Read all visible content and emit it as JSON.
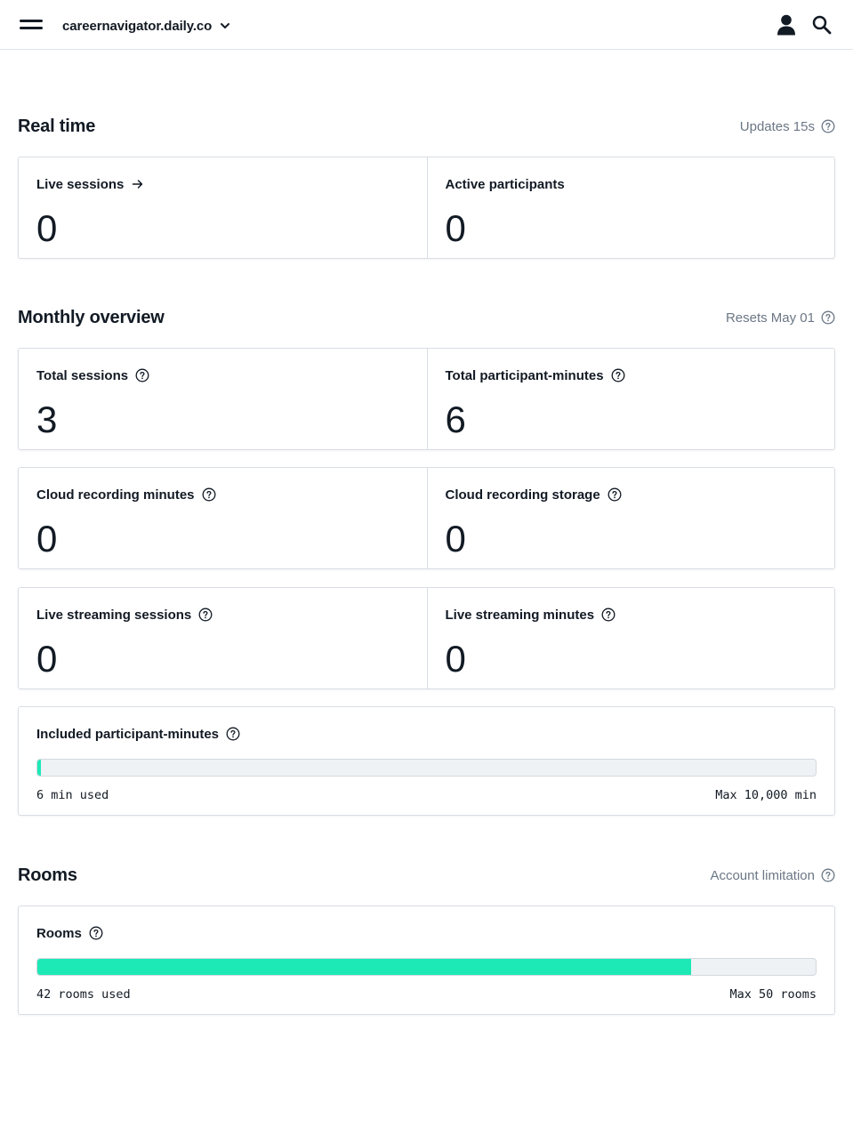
{
  "header": {
    "domain": "careernavigator.daily.co"
  },
  "realtime": {
    "title": "Real time",
    "meta": "Updates 15s",
    "live_sessions": {
      "label": "Live sessions",
      "value": "0"
    },
    "active_participants": {
      "label": "Active participants",
      "value": "0"
    }
  },
  "monthly": {
    "title": "Monthly overview",
    "meta": "Resets May 01",
    "total_sessions": {
      "label": "Total sessions",
      "value": "3"
    },
    "total_participant_minutes": {
      "label": "Total participant-minutes",
      "value": "6"
    },
    "cloud_recording_minutes": {
      "label": "Cloud recording minutes",
      "value": "0"
    },
    "cloud_recording_storage": {
      "label": "Cloud recording storage",
      "value": "0"
    },
    "live_streaming_sessions": {
      "label": "Live streaming sessions",
      "value": "0"
    },
    "live_streaming_minutes": {
      "label": "Live streaming minutes",
      "value": "0"
    },
    "included_minutes": {
      "label": "Included participant-minutes",
      "used_text": "6 min used",
      "max_text": "Max 10,000 min",
      "used": 6,
      "max": 10000,
      "min_display_fraction": 0.004
    }
  },
  "rooms": {
    "title": "Rooms",
    "meta": "Account limitation",
    "usage": {
      "label": "Rooms",
      "used_text": "42 rooms used",
      "max_text": "Max 50 rooms",
      "used": 42,
      "max": 50
    }
  },
  "colors": {
    "accent": "#1de9b6",
    "text": "#121a24",
    "muted": "#6b7785",
    "border": "#d9dee4",
    "bar_track": "#eff2f5"
  },
  "icons": {
    "menu": "hamburger-icon",
    "domain_switch": "chevron-down-icon",
    "user": "user-icon",
    "search": "search-icon",
    "help": "question-circle-icon",
    "link": "arrow-right-icon"
  }
}
